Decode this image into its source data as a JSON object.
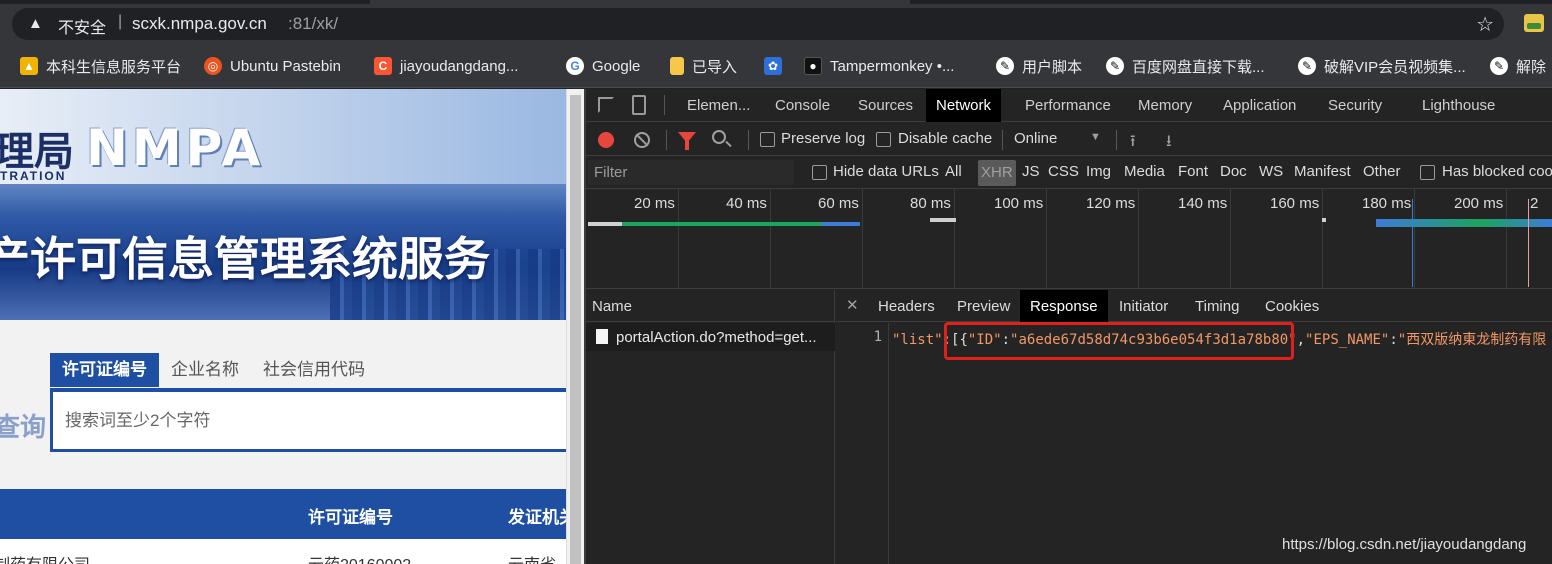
{
  "browser": {
    "security_label": "不安全",
    "separator": "|",
    "url_host": "scxk.nmpa.gov.cn",
    "url_rest": ":81/xk/"
  },
  "bookmarks": [
    {
      "label": "本科生信息服务平台",
      "icon": "graduation-icon",
      "color": "#f0b400"
    },
    {
      "label": "Ubuntu Pastebin",
      "icon": "ubuntu-icon",
      "color": "#e95420"
    },
    {
      "label": "jiayoudangdang...",
      "icon": "csdn-icon",
      "color": "#fc5531"
    },
    {
      "label": "Google",
      "icon": "google-icon",
      "color": "#4285f4"
    },
    {
      "label": "已导入",
      "icon": "folder-icon",
      "color": "#f6c84a"
    },
    {
      "label": "",
      "icon": "baidu-paw-icon",
      "color": "#2f6fd8"
    },
    {
      "label": "Tampermonkey •...",
      "icon": "tampermonkey-icon",
      "color": "#222222"
    },
    {
      "label": "用户脚本",
      "icon": "script-icon",
      "color": "#ffffff"
    },
    {
      "label": "百度网盘直接下载...",
      "icon": "script-icon",
      "color": "#ffffff"
    },
    {
      "label": "破解VIP会员视频集...",
      "icon": "script-icon",
      "color": "#ffffff"
    },
    {
      "label": "解除",
      "icon": "script-icon",
      "color": "#ffffff"
    }
  ],
  "page": {
    "agency_short": "理局",
    "agency_en": "TRATION",
    "logo": "NMPA",
    "system_title": "产许可信息管理系统服务",
    "search_tabs": [
      "许可证编号",
      "企业名称",
      "社会信用代码"
    ],
    "search_placeholder": "搜索词至少2个字符",
    "query_button": "查询",
    "table_headers": [
      "许可证编号",
      "发证机关"
    ],
    "row1": [
      "制药有限公司",
      "云药20160002",
      "云南省"
    ]
  },
  "devtools": {
    "tabs": [
      "Elemen...",
      "Console",
      "Sources",
      "Network",
      "Performance",
      "Memory",
      "Application",
      "Security",
      "Lighthouse"
    ],
    "active_tab": "Network",
    "toolbar": {
      "preserve_log": "Preserve log",
      "disable_cache": "Disable cache",
      "throttle": "Online"
    },
    "filter": {
      "placeholder": "Filter",
      "hide_data_urls": "Hide data URLs",
      "types": [
        "All",
        "XHR",
        "JS",
        "CSS",
        "Img",
        "Media",
        "Font",
        "Doc",
        "WS",
        "Manifest",
        "Other"
      ],
      "active_type": "XHR",
      "has_blocked": "Has blocked coo"
    },
    "timeline_ticks": [
      "20 ms",
      "40 ms",
      "60 ms",
      "80 ms",
      "100 ms",
      "120 ms",
      "140 ms",
      "160 ms",
      "180 ms",
      "200 ms",
      "2"
    ],
    "name_header": "Name",
    "request_name": "portalAction.do?method=get...",
    "detail_tabs": [
      "Headers",
      "Preview",
      "Response",
      "Initiator",
      "Timing",
      "Cookies"
    ],
    "active_detail_tab": "Response",
    "response": {
      "line_number": "1",
      "k1": "\"list\"",
      "p1": ":",
      "p2": "[{",
      "k2": "\"ID\"",
      "p3": ":",
      "k3": "\"a6ede67d58d74c93b6e054f3d1a78b80\"",
      "p4": ",",
      "k4": "\"EPS_NAME\"",
      "p5": ":",
      "k5": "\"西双版纳東龙制药有限"
    }
  },
  "watermark": "https://blog.csdn.net/jiayoudangdang"
}
